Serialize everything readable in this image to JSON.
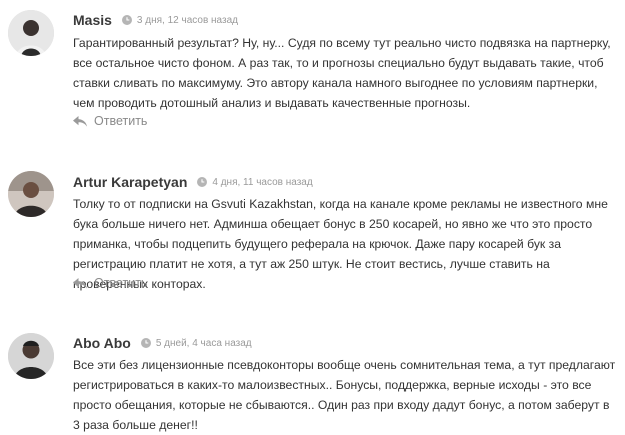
{
  "comments": [
    {
      "author": "Masis",
      "time": "3 дня, 12 часов назад",
      "text": "Гарантированный результат? Ну, ну... Судя по всему тут реально чисто подвязка на партнерку, все остальное чисто фоном. А раз так, то и прогнозы специально будут выдавать такие, чтоб ставки сливать по максимуму. Это автору канала намного выгоднее по условиям партнерки, чем проводить дотошный анализ и выдавать качественные прогнозы.",
      "reply_label": "Ответить"
    },
    {
      "author": "Artur Karapetyan",
      "time": "4 дня, 11 часов назад",
      "text": "Толку то от подписки на Gsvuti Kazakhstan, когда на канале кроме рекламы не известного мне бука больше ничего нет. Админша обещает бонус в 250 косарей, но явно же что это просто приманка, чтобы подцепить будущего реферала на крючок. Даже пару косарей бук за регистрацию платит не хотя, а тут аж 250 штук. Не стоит вестись, лучше ставить на проверенных конторах.",
      "reply_label": "Ответить"
    },
    {
      "author": "Abo Abo",
      "time": "5 дней, 4 часа назад",
      "text": "Все эти без лицензионные псевдоконторы вообще очень сомнительная тема, а тут предлагают регистрироваться в каких-то малоизвестных.. Бонусы, поддержка, верные исходы - это все просто обещания, которые не сбываются.. Один раз при входу дадут бонус, а потом заберут в 3 раза больше денег!!"
    }
  ],
  "icons": {
    "time": "clock-icon",
    "reply": "reply-arrow-icon"
  },
  "colors": {
    "author": "#3a3a3a",
    "meta": "#9a9a9a",
    "text": "#333333",
    "reply": "#8a8a8a"
  }
}
